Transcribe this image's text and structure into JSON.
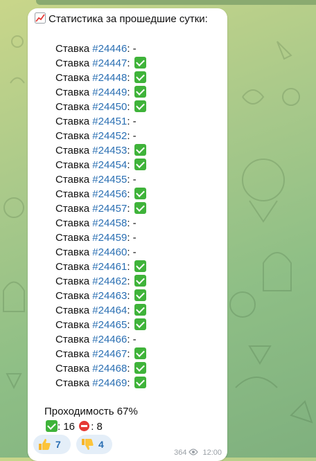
{
  "header": {
    "title": "Статистика за прошедшие сутки:",
    "icon": "chart-increasing-icon"
  },
  "bets": [
    {
      "label": "Ставка",
      "id": "#24446",
      "result": "-"
    },
    {
      "label": "Ставка",
      "id": "#24447",
      "result": "check"
    },
    {
      "label": "Ставка",
      "id": "#24448",
      "result": "check"
    },
    {
      "label": "Ставка",
      "id": "#24449",
      "result": "check"
    },
    {
      "label": "Ставка",
      "id": "#24450",
      "result": "check"
    },
    {
      "label": "Ставка",
      "id": "#24451",
      "result": "-"
    },
    {
      "label": "Ставка",
      "id": "#24452",
      "result": "-"
    },
    {
      "label": "Ставка",
      "id": "#24453",
      "result": "check"
    },
    {
      "label": "Ставка",
      "id": "#24454",
      "result": "check"
    },
    {
      "label": "Ставка",
      "id": "#24455",
      "result": "-"
    },
    {
      "label": "Ставка",
      "id": "#24456",
      "result": "check"
    },
    {
      "label": "Ставка",
      "id": "#24457",
      "result": "check"
    },
    {
      "label": "Ставка",
      "id": "#24458",
      "result": "-"
    },
    {
      "label": "Ставка",
      "id": "#24459",
      "result": "-"
    },
    {
      "label": "Ставка",
      "id": "#24460",
      "result": "-"
    },
    {
      "label": "Ставка",
      "id": "#24461",
      "result": "check"
    },
    {
      "label": "Ставка",
      "id": "#24462",
      "result": "check"
    },
    {
      "label": "Ставка",
      "id": "#24463",
      "result": "check"
    },
    {
      "label": "Ставка",
      "id": "#24464",
      "result": "check"
    },
    {
      "label": "Ставка",
      "id": "#24465",
      "result": "check"
    },
    {
      "label": "Ставка",
      "id": "#24466",
      "result": "-"
    },
    {
      "label": "Ставка",
      "id": "#24467",
      "result": "check"
    },
    {
      "label": "Ставка",
      "id": "#24468",
      "result": "check"
    },
    {
      "label": "Ставка",
      "id": "#24469",
      "result": "check"
    }
  ],
  "summary": {
    "pass_rate": "Проходимость 67%",
    "wins": "16",
    "losses": "8"
  },
  "reactions": [
    {
      "icon": "thumbs-up-icon",
      "count": "7"
    },
    {
      "icon": "thumbs-down-icon",
      "count": "4"
    }
  ],
  "meta": {
    "views": "364",
    "time": "12:00"
  },
  "colors": {
    "link": "#2a6fb3",
    "check": "#3fb33a",
    "stop": "#e53935",
    "reaction_bg": "#e4eef8"
  }
}
